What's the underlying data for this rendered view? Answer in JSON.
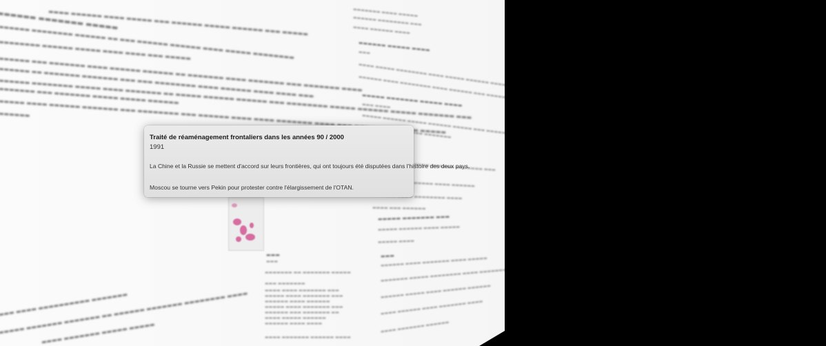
{
  "popover": {
    "title": "Traité de réaménagement frontaliers dans les années 90 / 2000",
    "year": "1991",
    "paragraphs": [
      "La Chine et la Russie se mettent d'accord sur leurs frontières, qui ont toujours été disputées dans l'histoire des deux pays.",
      "Moscou se tourne vers Pekin pour protester contre l'élargissement de l'OTAN."
    ]
  },
  "colors": {
    "background": "#000000",
    "panel": "#f5f5f5",
    "popover": "#e4e4e4",
    "map_accent": "#d04b8c"
  }
}
